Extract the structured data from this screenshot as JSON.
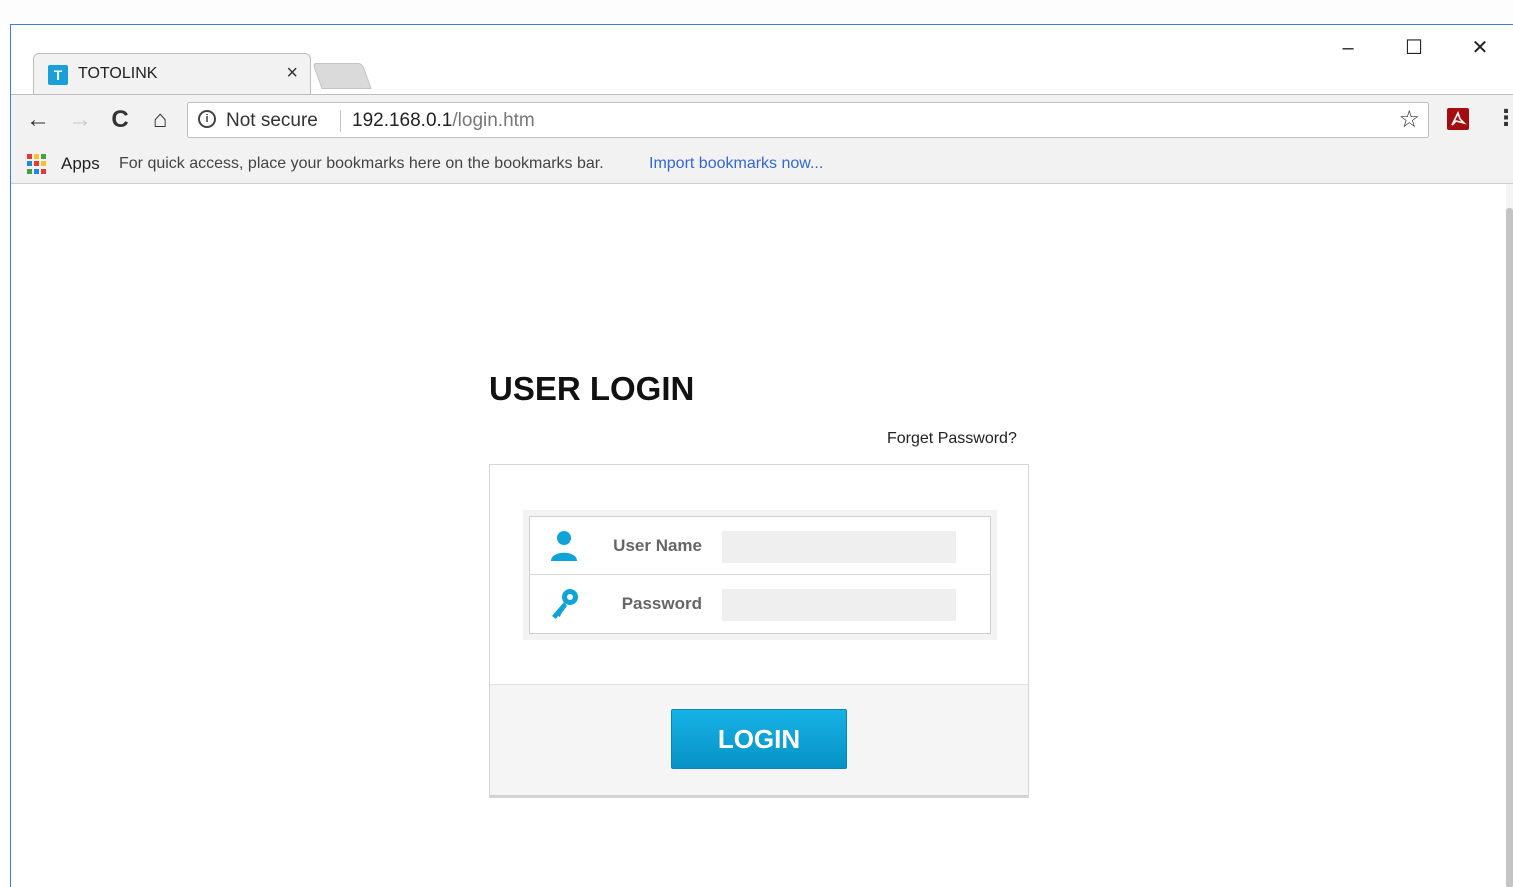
{
  "browser": {
    "tab_title": "TOTOLINK",
    "tab_favicon": "T",
    "tab_close": "×",
    "security_text": "Not secure",
    "url_host": "192.168.0.1",
    "url_path": "/login.htm",
    "minimize_glyph": "–",
    "maximize_glyph": "☐",
    "close_glyph": "✕",
    "back_glyph": "←",
    "forward_glyph": "→",
    "reload_glyph": "C",
    "home_glyph": "⌂",
    "star_glyph": "☆",
    "menu_glyph": "⋮"
  },
  "bookmarks": {
    "apps_label": "Apps",
    "hint": "For quick access, place your bookmarks here on the bookmarks bar.",
    "import_link": "Import bookmarks now..."
  },
  "login": {
    "title": "USER LOGIN",
    "forget_password": "Forget Password?",
    "username_label": "User Name",
    "username_value": "",
    "password_label": "Password",
    "password_value": "",
    "button_label": "LOGIN"
  },
  "colors": {
    "accent": "#0fa3d8",
    "window_border": "#3c7fd6",
    "link": "#3367d6"
  },
  "icons": [
    "info-icon",
    "star-icon",
    "acrobat-icon",
    "user-icon",
    "key-icon",
    "apps-grid-icon"
  ]
}
